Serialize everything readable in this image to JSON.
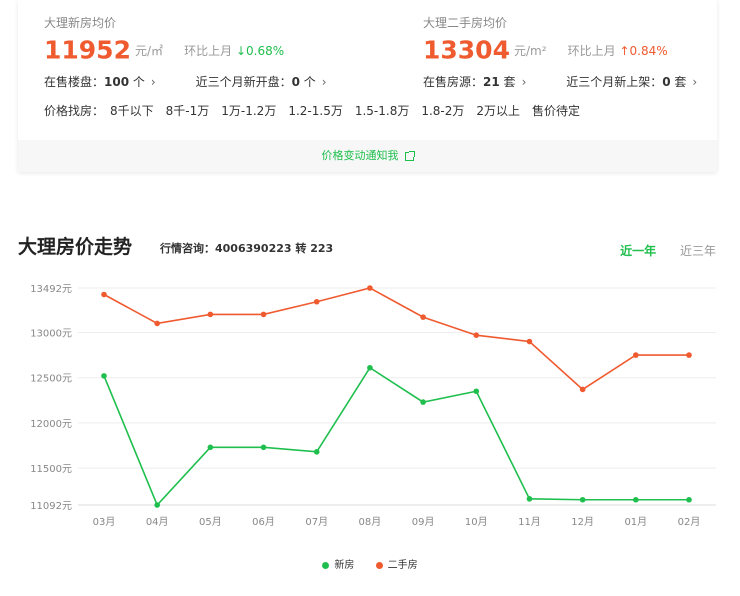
{
  "summary": {
    "new": {
      "label": "大理新房均价",
      "price": "11952",
      "unit": "元/㎡",
      "mom_label": "环比上月",
      "mom_value": "↓0.68%",
      "stat1_label": "在售楼盘：",
      "stat1_value": "100",
      "stat1_unit": "个",
      "stat2_label": "近三个月新开盘：",
      "stat2_value": "0",
      "stat2_unit": "个"
    },
    "second": {
      "label": "大理二手房均价",
      "price": "13304",
      "unit": "元/m²",
      "mom_label": "环比上月",
      "mom_value": "↑0.84%",
      "stat1_label": "在售房源：",
      "stat1_value": "21",
      "stat1_unit": "套",
      "stat2_label": "近三个月新上架：",
      "stat2_value": "0",
      "stat2_unit": "套"
    },
    "filter_label": "价格找房：",
    "filters": [
      "8千以下",
      "8千-1万",
      "1万-1.2万",
      "1.2-1.5万",
      "1.5-1.8万",
      "1.8-2万",
      "2万以上",
      "售价待定"
    ],
    "notify_text": "价格变动通知我"
  },
  "trend": {
    "title": "大理房价走势",
    "hotline": "行情咨询：4006390223 转 223",
    "tabs": [
      "近一年",
      "近三年"
    ],
    "active_tab": 0
  },
  "colors": {
    "new": "#1fbf4e",
    "second": "#ef5a2f"
  },
  "chart_data": {
    "type": "line",
    "categories": [
      "03月",
      "04月",
      "05月",
      "06月",
      "07月",
      "08月",
      "09月",
      "10月",
      "11月",
      "12月",
      "01月",
      "02月"
    ],
    "y_ticks": [
      "13492元",
      "13000元",
      "12500元",
      "12000元",
      "11500元",
      "11092元"
    ],
    "ylim": [
      11092,
      13492
    ],
    "series": [
      {
        "name": "新房",
        "values": [
          12520,
          11092,
          11730,
          11730,
          11680,
          12610,
          12230,
          12350,
          11160,
          11150,
          11150,
          11150
        ]
      },
      {
        "name": "二手房",
        "values": [
          13420,
          13100,
          13200,
          13200,
          13340,
          13492,
          13170,
          12970,
          12900,
          12370,
          12750,
          12750
        ]
      }
    ]
  }
}
